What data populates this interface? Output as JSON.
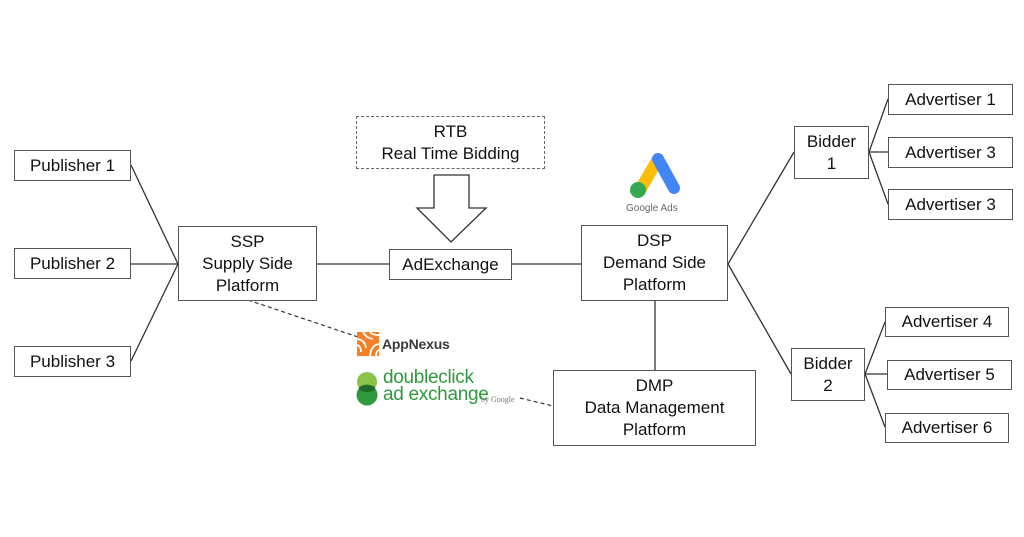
{
  "diagram": {
    "publishers": [
      {
        "label": "Publisher 1"
      },
      {
        "label": "Publisher 2"
      },
      {
        "label": "Publisher 3"
      }
    ],
    "ssp": {
      "lines": [
        "SSP",
        "Supply Side",
        "Platform"
      ]
    },
    "adexchange": {
      "label": "AdExchange"
    },
    "rtb": {
      "lines": [
        "RTB",
        "Real Time Bidding"
      ]
    },
    "dsp": {
      "lines": [
        "DSP",
        "Demand Side",
        "Platform"
      ]
    },
    "dmp": {
      "lines": [
        "DMP",
        "Data Management",
        "Platform"
      ]
    },
    "bidders": [
      {
        "lines": [
          "Bidder",
          "1"
        ]
      },
      {
        "lines": [
          "Bidder",
          "2"
        ]
      }
    ],
    "advertisers": [
      {
        "label": "Advertiser 1"
      },
      {
        "label": "Advertiser 3"
      },
      {
        "label": "Advertiser 3"
      },
      {
        "label": "Advertiser 4"
      },
      {
        "label": "Advertiser 5"
      },
      {
        "label": "Advertiser 6"
      }
    ],
    "logos": {
      "google_ads": {
        "text": "Google Ads",
        "colors": {
          "blue": "#4285F4",
          "yellow": "#FBBC04",
          "green": "#34A853"
        }
      },
      "appnexus": {
        "text": "AppNexus",
        "color": "#F58025"
      },
      "doubleclick": {
        "line1": "doubleclick",
        "line2": "ad exchange",
        "byline": "by Google",
        "colors": {
          "light": "#8BC34A",
          "dark": "#1E7E34",
          "text": "#2e9a3c"
        }
      }
    }
  }
}
